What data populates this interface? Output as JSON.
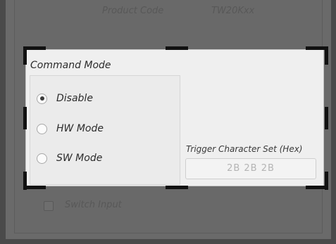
{
  "background": {
    "product_code_label": "Product Code",
    "product_code_value": "TW20Kxx",
    "checkbox_label": "Switch Input"
  },
  "command_mode": {
    "title": "Command Mode",
    "options": [
      {
        "label": "Disable",
        "checked": true
      },
      {
        "label": "HW Mode",
        "checked": false
      },
      {
        "label": "SW Mode",
        "checked": false
      }
    ]
  },
  "trigger": {
    "label": "Trigger Character Set (Hex)",
    "value": "2B 2B 2B"
  }
}
